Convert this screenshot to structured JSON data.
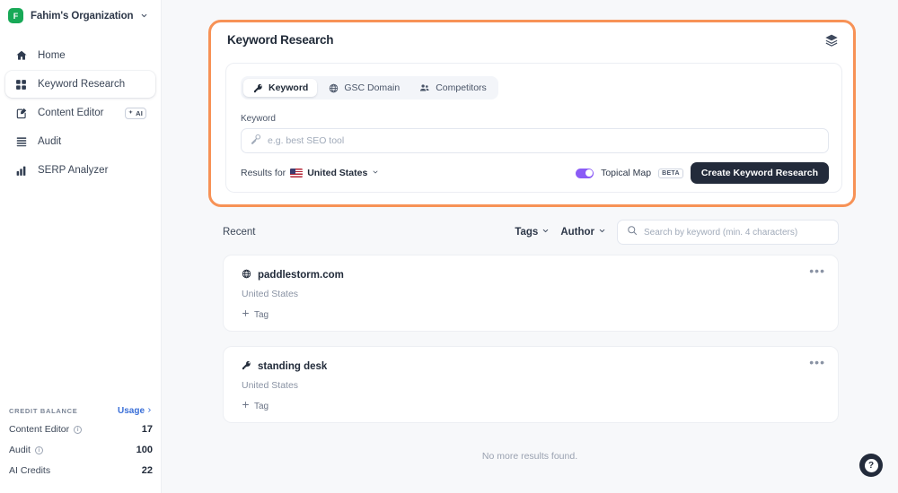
{
  "sidebar": {
    "org": {
      "initial": "F",
      "name": "Fahim's Organization",
      "chevron_icon": "chevron-down-icon"
    },
    "items": [
      {
        "label": "Home",
        "icon": "home-icon",
        "active": false
      },
      {
        "label": "Keyword Research",
        "icon": "grid-icon",
        "active": true
      },
      {
        "label": "Content Editor",
        "icon": "edit-document-icon",
        "active": false,
        "badge": "AI"
      },
      {
        "label": "Audit",
        "icon": "list-lines-icon",
        "active": false
      },
      {
        "label": "SERP Analyzer",
        "icon": "bar-chart-icon",
        "active": false
      }
    ],
    "credit": {
      "title": "CREDIT BALANCE",
      "usage_label": "Usage",
      "rows": [
        {
          "label": "Content Editor",
          "value": "17",
          "info": true
        },
        {
          "label": "Audit",
          "value": "100",
          "info": true
        },
        {
          "label": "AI Credits",
          "value": "22",
          "info": false
        }
      ]
    }
  },
  "panel": {
    "title": "Keyword Research",
    "stack_icon": "layers-icon",
    "tabs": [
      {
        "label": "Keyword",
        "icon": "key-icon",
        "active": true
      },
      {
        "label": "GSC Domain",
        "icon": "globe-icon",
        "active": false
      },
      {
        "label": "Competitors",
        "icon": "people-icon",
        "active": false
      }
    ],
    "field_label": "Keyword",
    "keyword_input": {
      "value": "",
      "placeholder": "e.g. best SEO tool",
      "icon": "key-icon"
    },
    "results_for_label": "Results for",
    "country": "United States",
    "country_flag": "us-flag-icon",
    "country_chevron": "chevron-down-icon",
    "topical_map_label": "Topical Map",
    "topical_map_enabled": true,
    "beta_badge": "BETA",
    "create_button": "Create Keyword Research"
  },
  "recent": {
    "title": "Recent",
    "tags_filter": "Tags",
    "author_filter": "Author",
    "search": {
      "value": "",
      "placeholder": "Search by keyword (min. 4 characters)",
      "icon": "search-icon"
    },
    "cards": [
      {
        "title": "paddlestorm.com",
        "icon": "globe-icon",
        "country": "United States",
        "tag_label": "Tag",
        "more_icon": "ellipsis-icon"
      },
      {
        "title": "standing desk",
        "icon": "key-icon",
        "country": "United States",
        "tag_label": "Tag",
        "more_icon": "ellipsis-icon"
      }
    ],
    "empty_text": "No more results found."
  },
  "help": {
    "label": "?",
    "icon": "question-mark-icon"
  },
  "colors": {
    "highlight_orange": "#f79256",
    "toggle_purple": "#8b5cf6",
    "avatar_green": "#18a957",
    "dark_button": "#232b3b",
    "link_blue": "#3a6fd8",
    "page_bg": "#f7f8fa"
  }
}
